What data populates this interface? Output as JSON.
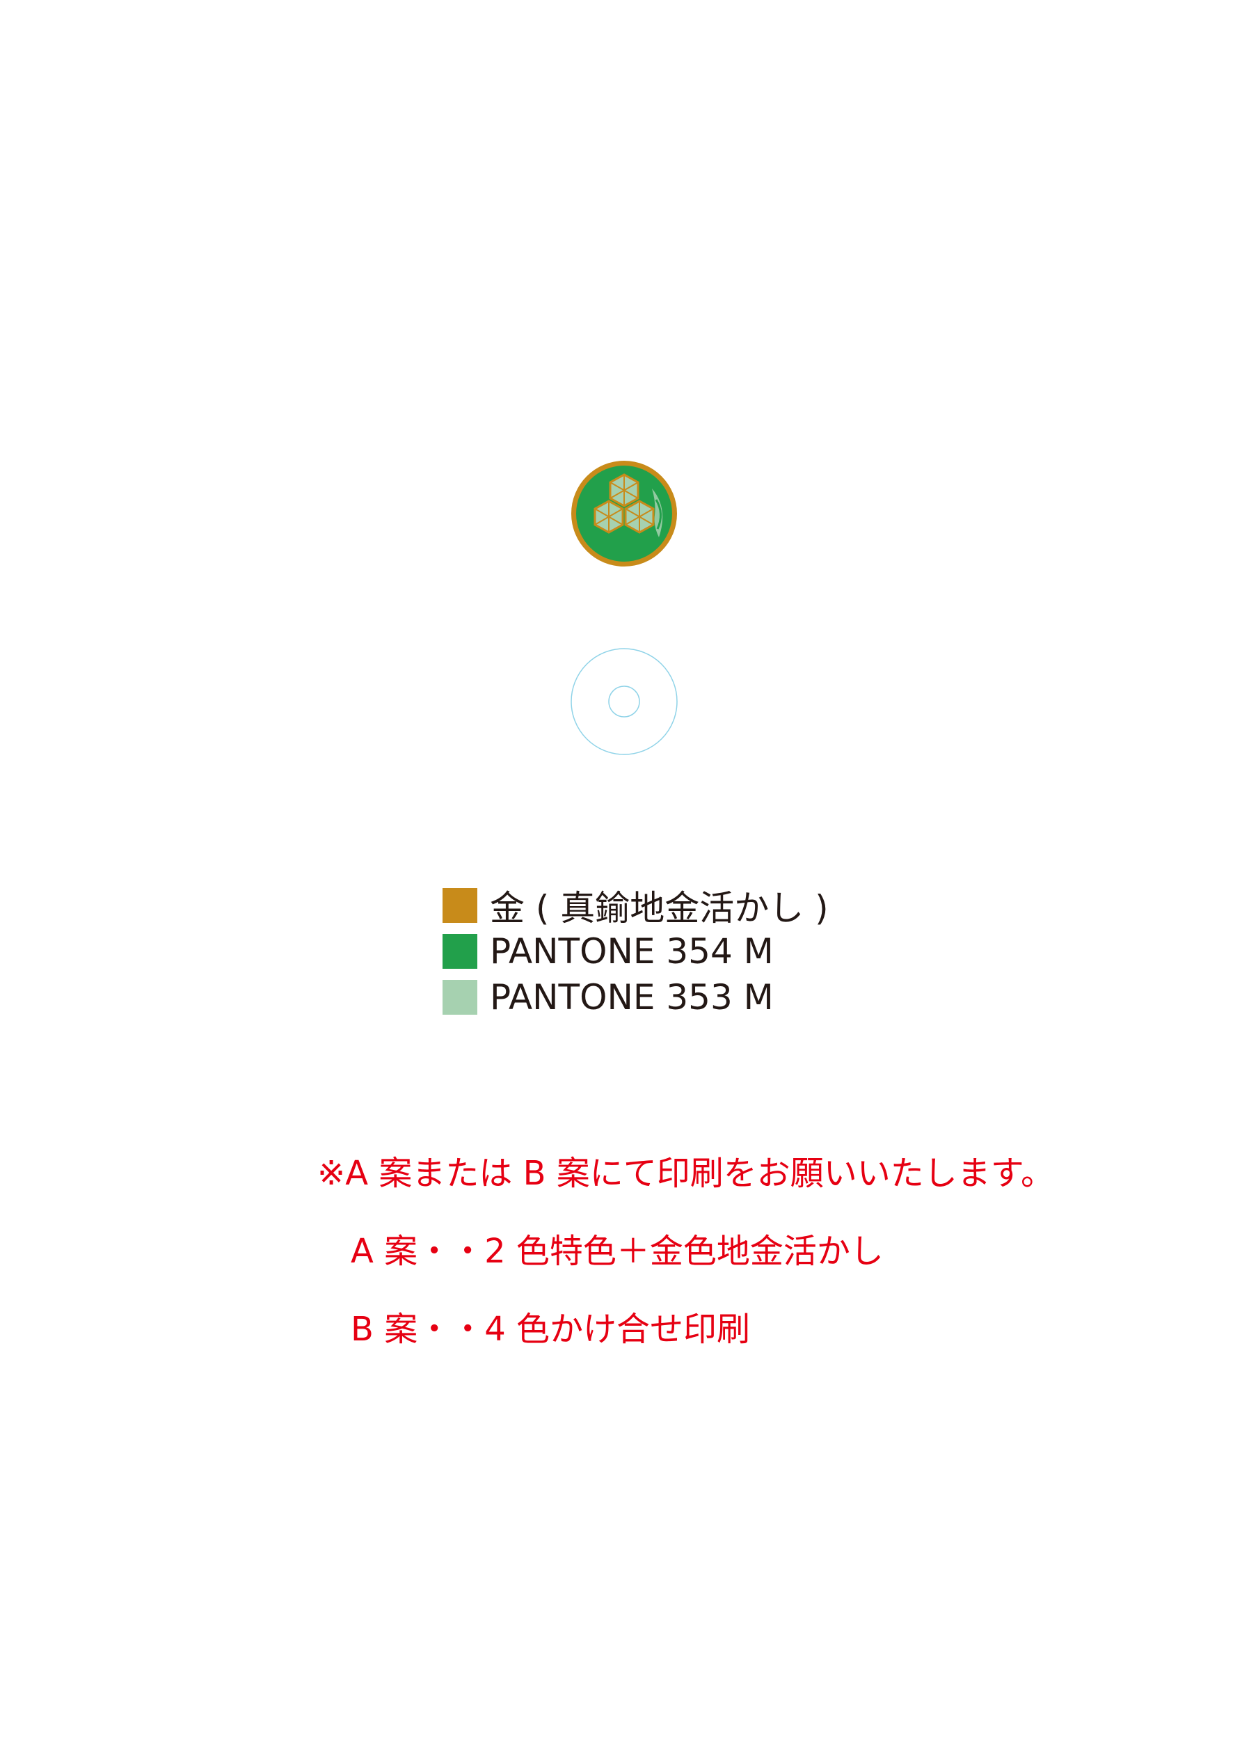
{
  "colors": {
    "gold": "#c88b1a",
    "green": "#22a04b",
    "light_green": "#a6d1b0",
    "note_red": "#e60012",
    "disc_outline": "#8fd3e8"
  },
  "emblem": {
    "icon": "hexagon-family-crest-icon"
  },
  "disc": {
    "icon": "disc-guide-outline-icon"
  },
  "legend": [
    {
      "label": "金 ( 真鍮地金活かし )",
      "color": "#c88b1a"
    },
    {
      "label": "PANTONE 354 M",
      "color": "#22a04b"
    },
    {
      "label": "PANTONE 353 M",
      "color": "#a6d1b0"
    }
  ],
  "notes": [
    "※A 案または B 案にて印刷をお願いいたします。",
    "A 案・・2 色特色＋金色地金活かし",
    "B 案・・4 色かけ合せ印刷"
  ]
}
